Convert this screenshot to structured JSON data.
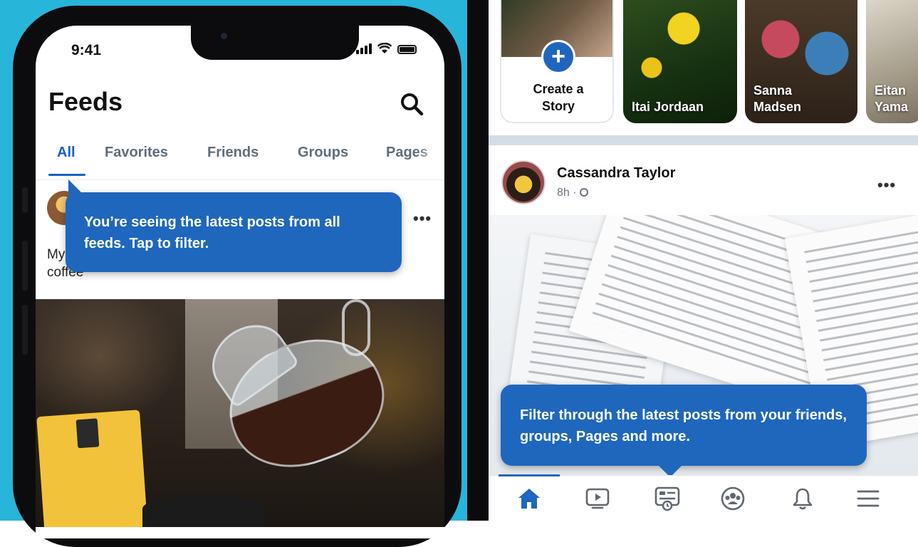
{
  "left_screen": {
    "status_bar": {
      "time": "9:41"
    },
    "header": {
      "title": "Feeds",
      "search_icon": "search-icon"
    },
    "tabs": [
      {
        "label": "All",
        "active": true
      },
      {
        "label": "Favorites",
        "active": false
      },
      {
        "label": "Friends",
        "active": false
      },
      {
        "label": "Groups",
        "active": false
      },
      {
        "label": "Pages",
        "active": false
      }
    ],
    "tooltip": "You’re seeing the latest posts from all feeds. Tap to filter.",
    "post": {
      "text": "My coffee",
      "more_icon": "more-icon"
    }
  },
  "right_screen": {
    "stories": {
      "create": {
        "label_line1": "Create a",
        "label_line2": "Story"
      },
      "items": [
        {
          "name_line1": "Itai Jordaan",
          "name_line2": ""
        },
        {
          "name_line1": "Sanna",
          "name_line2": "Madsen"
        },
        {
          "name_line1": "Eitan",
          "name_line2": "Yama"
        }
      ]
    },
    "post": {
      "author": "Cassandra Taylor",
      "time": "8h",
      "separator": "·",
      "more_icon": "more-icon"
    },
    "tooltip": "Filter through the latest posts from your friends, groups, Pages and more.",
    "bottom_nav": [
      "home-icon",
      "video-icon",
      "feeds-icon",
      "groups-icon",
      "notifications-icon",
      "menu-icon"
    ]
  },
  "colors": {
    "accent": "#1f67bd",
    "active_tab": "#1461c8",
    "background_left": "#27b5d9",
    "inactive_tab": "#5f6e7d"
  }
}
